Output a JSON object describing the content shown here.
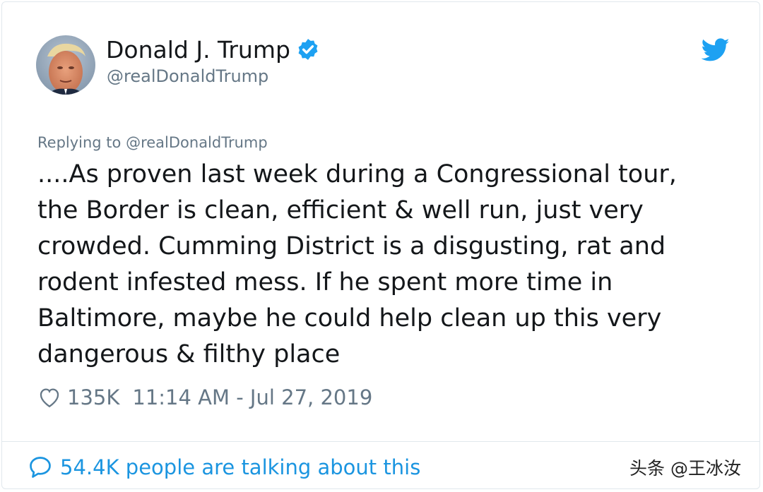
{
  "tweet": {
    "author_name": "Donald J. Trump",
    "author_handle": "@realDonaldTrump",
    "verified_icon": "verified-badge-icon",
    "brand_icon": "twitter-bird-icon",
    "replying_to": "Replying to @realDonaldTrump",
    "body_lines": [
      "....As proven last week during a Congressional tour,",
      "the Border is clean, efficient & well run, just very",
      "crowded. Cumming District is a disgusting, rat and",
      "rodent infested mess. If he spent more time in",
      "Baltimore, maybe he could help clean up this very",
      "dangerous & filthy place"
    ],
    "like_icon": "heart-icon",
    "like_count": "135K",
    "timestamp": "11:14 AM - Jul 27, 2019",
    "talking_icon": "speech-bubble-icon",
    "talking_text": "54.4K people are talking about this"
  },
  "watermark": "头条 @王冰汝",
  "colors": {
    "accent": "#1da1f2",
    "link": "#1b95e0",
    "secondary_text": "#657786",
    "primary_text": "#14171a",
    "border": "#e1e8ed"
  }
}
